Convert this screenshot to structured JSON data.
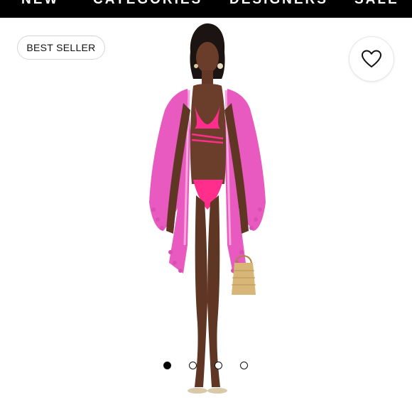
{
  "nav": {
    "items": [
      "NEW",
      "CATEGORIES",
      "DESIGNERS",
      "SALE"
    ]
  },
  "badge": {
    "label": "BEST SELLER"
  },
  "wishlist": {
    "icon": "heart-icon"
  },
  "carousel": {
    "total": 4,
    "active_index": 0
  },
  "colors": {
    "nav_bg": "#000000",
    "accent_pink": "#e0409c",
    "bikini_pink": "#ff2e8c"
  }
}
